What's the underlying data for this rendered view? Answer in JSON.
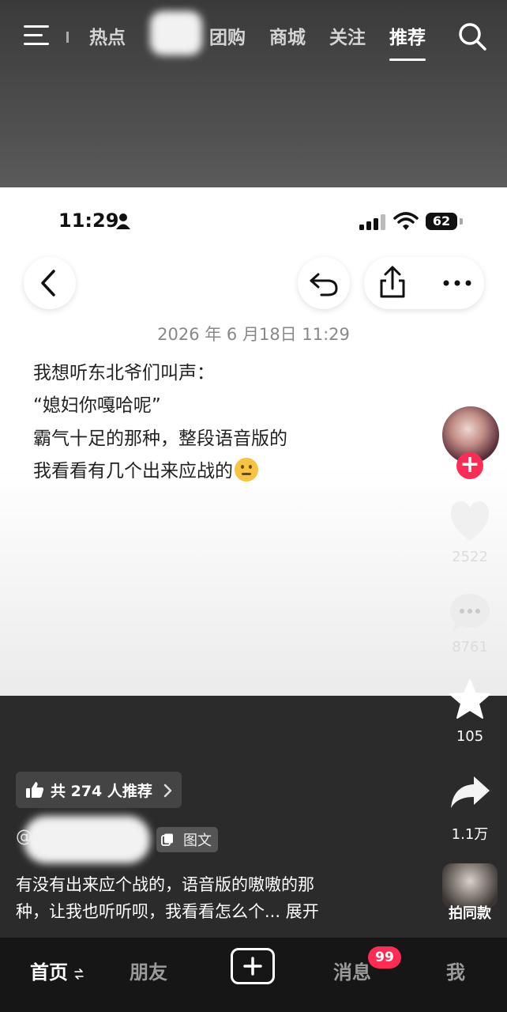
{
  "top_nav": {
    "tabs": [
      "热点",
      "团购",
      "商城",
      "关注",
      "推荐"
    ],
    "active_tab": "推荐"
  },
  "post": {
    "status_time": "11:29",
    "battery": "62",
    "date": "2026 年 6 月18日 11:29",
    "lines": [
      "我想听东北爷们叫声：",
      "“媳妇你嘎哈呢”",
      "霸气十足的那种，整段语音版的",
      "我看看有几个出来应战的"
    ]
  },
  "actions": {
    "likes": "2522",
    "comments": "8761",
    "favorites": "105",
    "shares": "1.1万",
    "same_style": "拍同款"
  },
  "info": {
    "recommend": "共 274 人推荐",
    "tag": "图文",
    "caption_line1": "有没有出来应个战的，语音版的嗷嗷的那",
    "caption_line2": "种，让我也听听呗，我看看怎么个...",
    "expand": "展开"
  },
  "bottom_nav": {
    "home": "首页",
    "friends": "朋友",
    "messages": "消息",
    "messages_badge": "99",
    "me": "我"
  },
  "colors": {
    "accent": "#fe2c55",
    "bottom_bar": "#161616"
  }
}
